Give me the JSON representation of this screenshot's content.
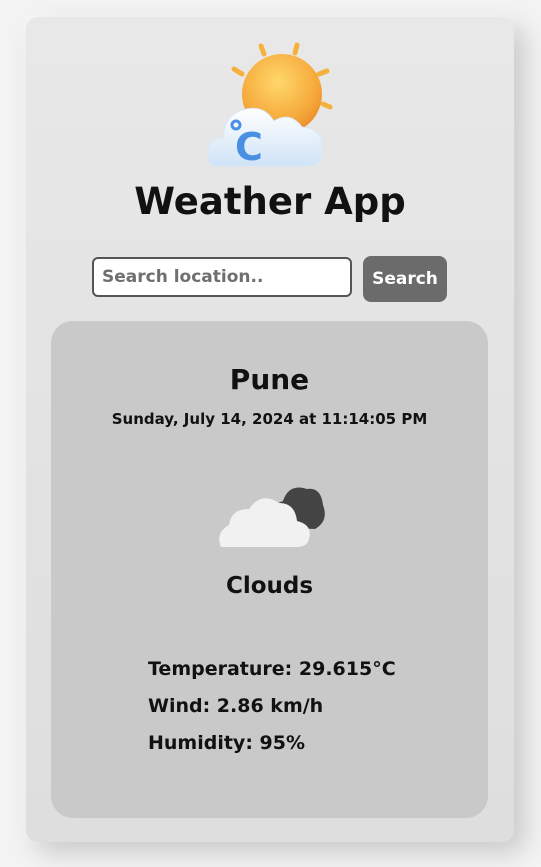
{
  "app": {
    "title": "Weather App",
    "logo_icon": "sun-behind-cloud-celsius-icon"
  },
  "search": {
    "placeholder": "Search location..",
    "value": "",
    "button_label": "Search"
  },
  "weather": {
    "city": "Pune",
    "datetime": "Sunday, July 14, 2024 at 11:14:05 PM",
    "icon": "clouds-icon",
    "condition": "Clouds",
    "temperature_text": "Temperature: 29.615°C",
    "wind_text": "Wind: 2.86 km/h",
    "humidity_text": "Humidity: 95%"
  },
  "colors": {
    "card_background": "#e4e4e4",
    "panel_background": "#c9c9c9",
    "button_background": "#6b6b6b",
    "logo_sun": "#f7b733",
    "logo_celsius": "#4a90e2"
  }
}
